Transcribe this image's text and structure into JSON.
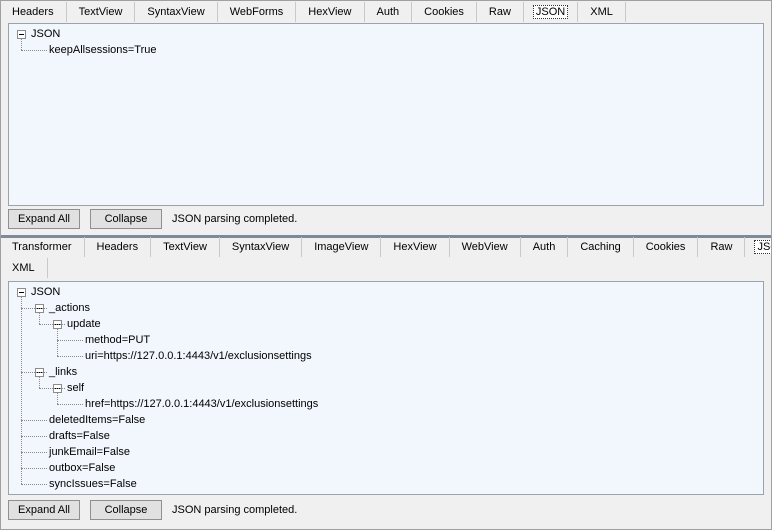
{
  "request_tabs": [
    {
      "label": "Headers",
      "active": false
    },
    {
      "label": "TextView",
      "active": false
    },
    {
      "label": "SyntaxView",
      "active": false
    },
    {
      "label": "WebForms",
      "active": false
    },
    {
      "label": "HexView",
      "active": false
    },
    {
      "label": "Auth",
      "active": false
    },
    {
      "label": "Cookies",
      "active": false
    },
    {
      "label": "Raw",
      "active": false
    },
    {
      "label": "JSON",
      "active": true
    },
    {
      "label": "XML",
      "active": false
    }
  ],
  "request_tree": [
    {
      "text": "JSON",
      "depth": 0,
      "expandable": true
    },
    {
      "text": "keepAllsessions=True",
      "depth": 1,
      "expandable": false
    }
  ],
  "request_footer": {
    "expand_label": "Expand All",
    "collapse_label": "Collapse",
    "status": "JSON parsing completed."
  },
  "response_tabs_row1": [
    {
      "label": "Transformer",
      "active": false
    },
    {
      "label": "Headers",
      "active": false
    },
    {
      "label": "TextView",
      "active": false
    },
    {
      "label": "SyntaxView",
      "active": false
    },
    {
      "label": "ImageView",
      "active": false
    },
    {
      "label": "HexView",
      "active": false
    },
    {
      "label": "WebView",
      "active": false
    },
    {
      "label": "Auth",
      "active": false
    },
    {
      "label": "Caching",
      "active": false
    },
    {
      "label": "Cookies",
      "active": false
    },
    {
      "label": "Raw",
      "active": false
    },
    {
      "label": "JSON",
      "active": true
    }
  ],
  "response_tabs_row2": [
    {
      "label": "XML",
      "active": false
    }
  ],
  "response_tree": [
    {
      "text": "JSON",
      "depth": 0,
      "expandable": true
    },
    {
      "text": "_actions",
      "depth": 1,
      "expandable": true
    },
    {
      "text": "update",
      "depth": 2,
      "expandable": true
    },
    {
      "text": "method=PUT",
      "depth": 3,
      "expandable": false
    },
    {
      "text": "uri=https://127.0.0.1:4443/v1/exclusionsettings",
      "depth": 3,
      "expandable": false
    },
    {
      "text": "_links",
      "depth": 1,
      "expandable": true
    },
    {
      "text": "self",
      "depth": 2,
      "expandable": true
    },
    {
      "text": "href=https://127.0.0.1:4443/v1/exclusionsettings",
      "depth": 3,
      "expandable": false
    },
    {
      "text": "deletedItems=False",
      "depth": 1,
      "expandable": false
    },
    {
      "text": "drafts=False",
      "depth": 1,
      "expandable": false
    },
    {
      "text": "junkEmail=False",
      "depth": 1,
      "expandable": false
    },
    {
      "text": "outbox=False",
      "depth": 1,
      "expandable": false
    },
    {
      "text": "syncIssues=False",
      "depth": 1,
      "expandable": false
    }
  ],
  "response_footer": {
    "expand_label": "Expand All",
    "collapse_label": "Collapse",
    "status": "JSON parsing completed."
  }
}
